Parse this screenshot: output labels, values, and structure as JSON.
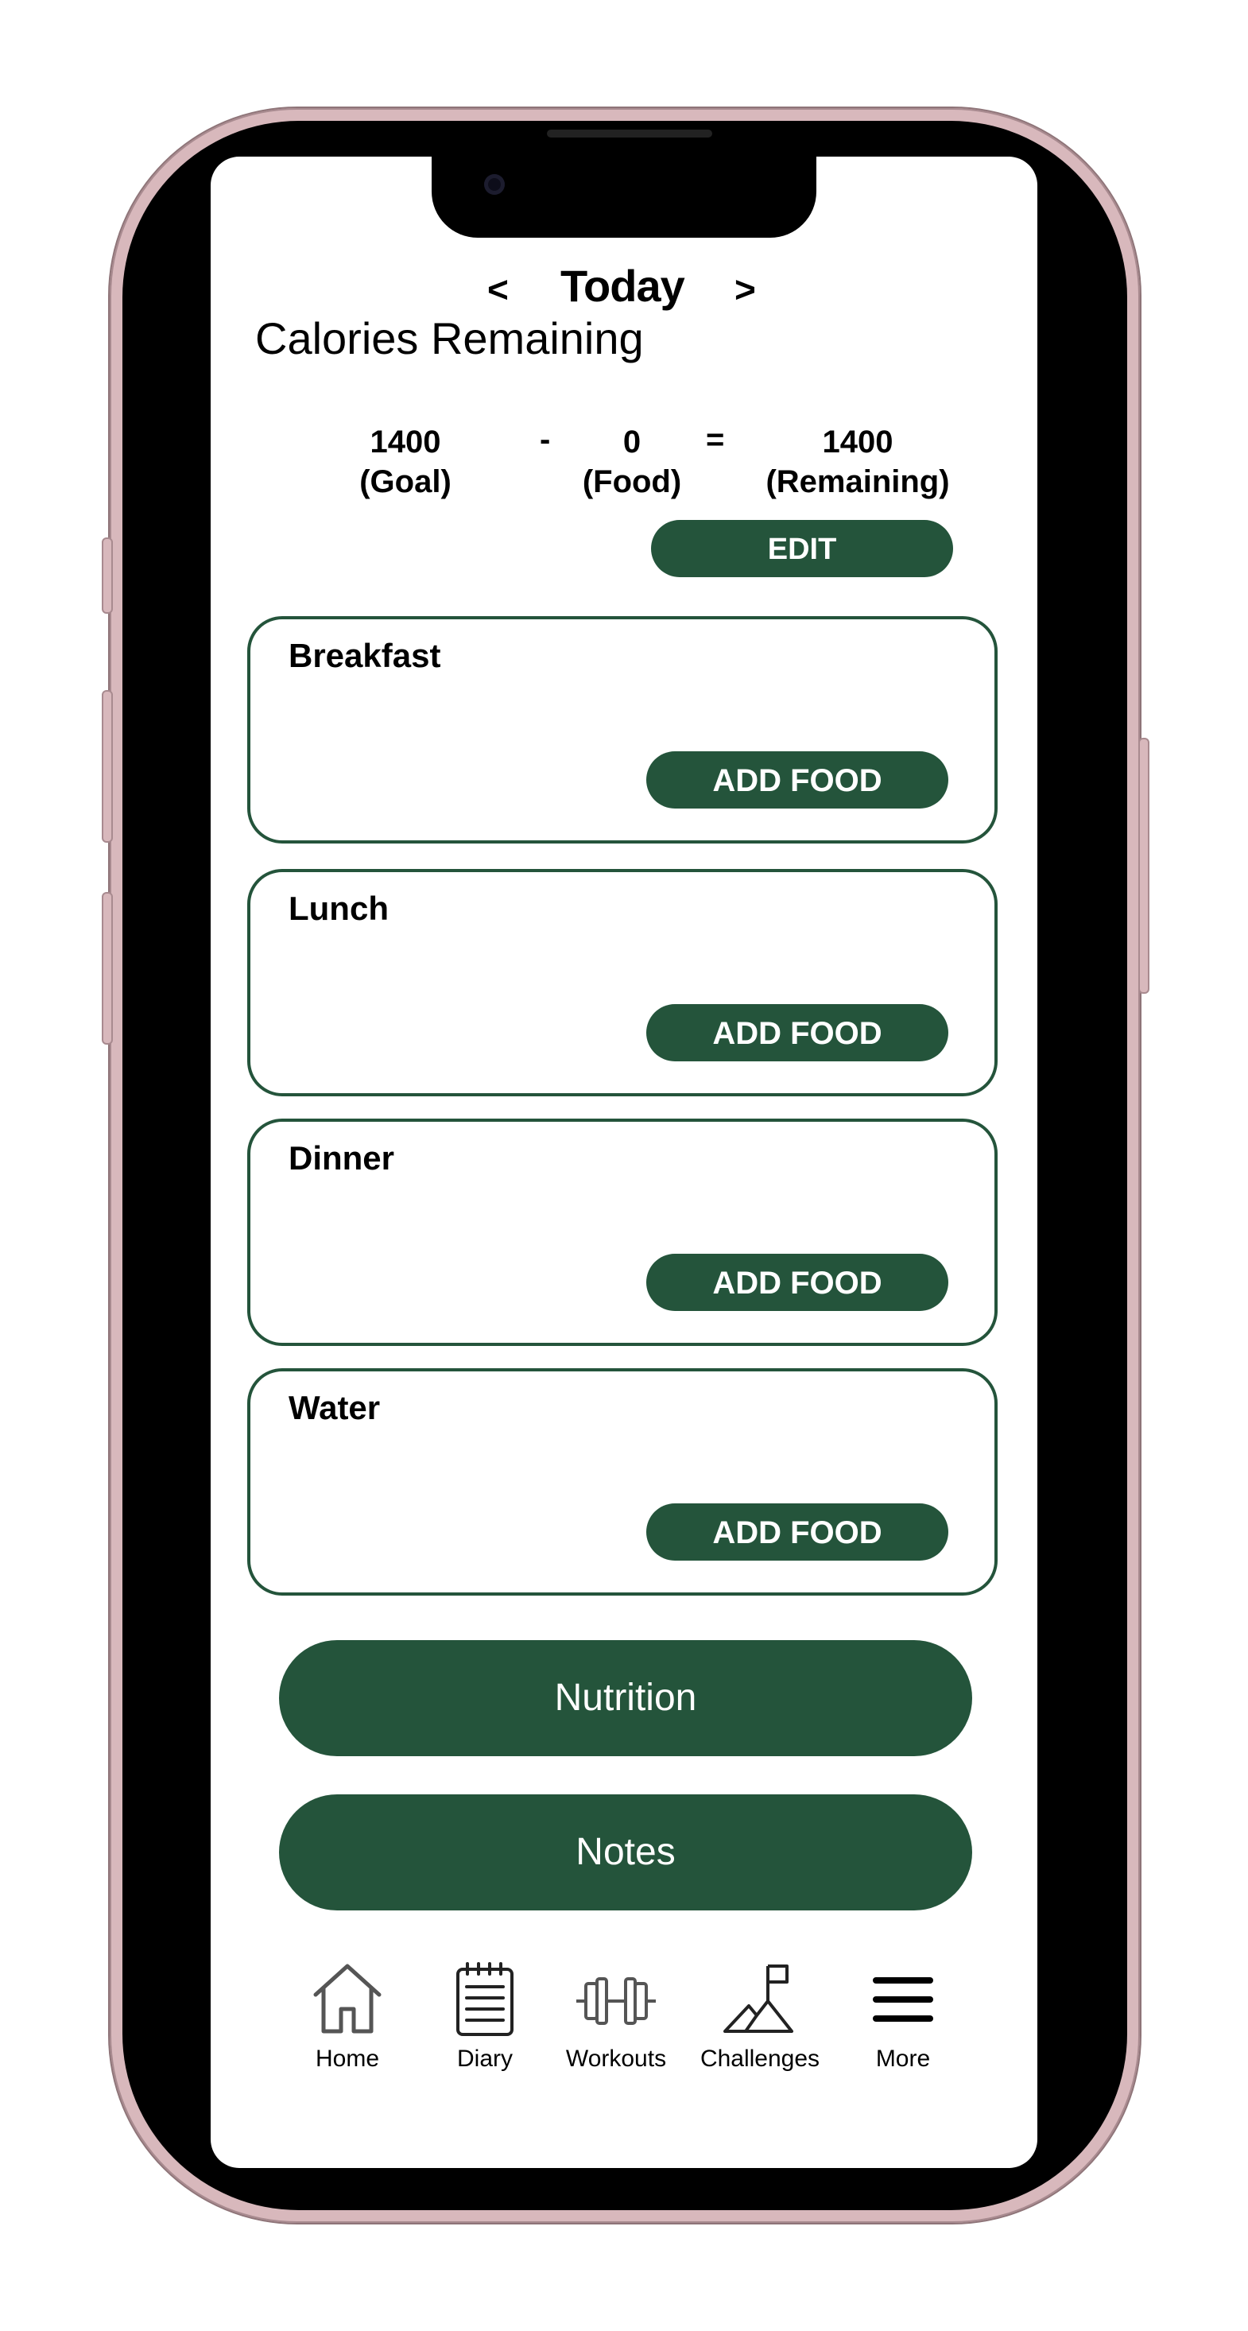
{
  "header": {
    "prev_label": "<",
    "title": "Today",
    "next_label": ">"
  },
  "calories": {
    "section_title": "Calories Remaining",
    "goal_value": "1400",
    "goal_label": "(Goal)",
    "minus": "-",
    "food_value": "0",
    "food_label": "(Food)",
    "equals": "=",
    "remaining_value": "1400",
    "remaining_label": "(Remaining)",
    "edit_label": "EDIT"
  },
  "meals": [
    {
      "name": "Breakfast",
      "button": "ADD FOOD"
    },
    {
      "name": "Lunch",
      "button": "ADD FOOD"
    },
    {
      "name": "Dinner",
      "button": "ADD FOOD"
    },
    {
      "name": "Water",
      "button": "ADD FOOD"
    }
  ],
  "actions": {
    "nutrition_label": "Nutrition",
    "notes_label": "Notes"
  },
  "tabbar": [
    {
      "label": "Home",
      "icon": "home-icon"
    },
    {
      "label": "Diary",
      "icon": "notepad-icon"
    },
    {
      "label": "Workouts",
      "icon": "dumbbell-icon"
    },
    {
      "label": "Challenges",
      "icon": "mountain-flag-icon"
    },
    {
      "label": "More",
      "icon": "hamburger-menu-icon"
    }
  ],
  "colors": {
    "accent": "#24543b",
    "frame": "#d8b8bc"
  }
}
